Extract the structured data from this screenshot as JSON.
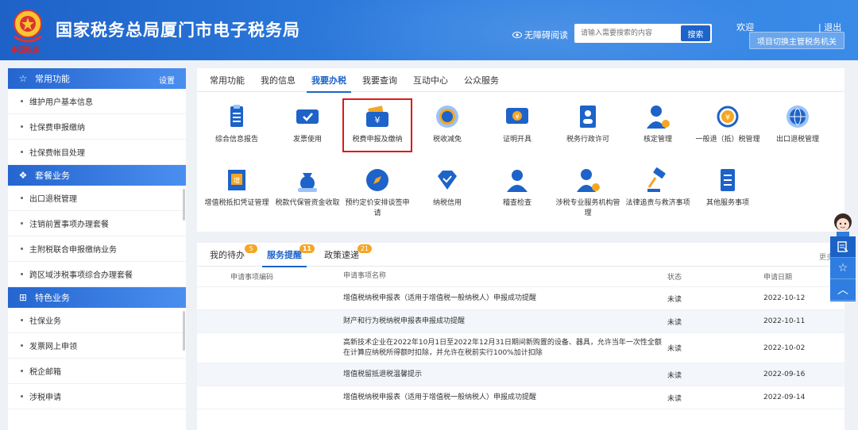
{
  "header": {
    "emblem_text": "中国税务",
    "title": "国家税务总局厦门市电子税务局",
    "accessibility": "无障碍阅读",
    "search_placeholder": "请输入需要搜索的内容",
    "search_button": "搜索",
    "welcome": "欢迎",
    "logout": "| 退出",
    "switch_agency": "项目切换主管税务机关"
  },
  "sidebar": {
    "sections": [
      {
        "title": "常用功能",
        "icon": "star-icon",
        "settings": "设置",
        "items": [
          "维护用户基本信息",
          "社保费申报缴纳",
          "社保费帐目处理"
        ]
      },
      {
        "title": "套餐业务",
        "icon": "layers-icon",
        "items": [
          "出口退税管理",
          "注销前置事项办理套餐",
          "主附税联合申报缴纳业务",
          "跨区域涉税事项综合办理套餐"
        ]
      },
      {
        "title": "特色业务",
        "icon": "grid-icon",
        "items": [
          "社保业务",
          "发票网上申领",
          "税企邮箱",
          "涉税申请"
        ]
      }
    ]
  },
  "main_tabs": [
    "常用功能",
    "我的信息",
    "我要办税",
    "我要查询",
    "互动中心",
    "公众服务"
  ],
  "active_main_tab": 2,
  "services": [
    {
      "label": "综合信息报告",
      "icon": "clipboard-icon"
    },
    {
      "label": "发票使用",
      "icon": "ticket-icon"
    },
    {
      "label": "税费申报及缴纳",
      "icon": "wallet-icon"
    },
    {
      "label": "税收减免",
      "icon": "coin-icon"
    },
    {
      "label": "证明开具",
      "icon": "certificate-icon"
    },
    {
      "label": "税务行政许可",
      "icon": "id-card-icon"
    },
    {
      "label": "核定管理",
      "icon": "user-gear-icon"
    },
    {
      "label": "一般退（抵）税管理",
      "icon": "refund-icon"
    },
    {
      "label": "出口退税管理",
      "icon": "globe-icon"
    },
    {
      "label": "增值税抵扣凭证管理",
      "icon": "invoice-icon"
    },
    {
      "label": "税款代保管资金收取",
      "icon": "money-bag-icon"
    },
    {
      "label": "预约定价安排谈签申请",
      "icon": "compass-icon"
    },
    {
      "label": "纳税信用",
      "icon": "diamond-icon"
    },
    {
      "label": "稽查检查",
      "icon": "inspector-icon"
    },
    {
      "label": "涉税专业服务机构管理",
      "icon": "agency-icon"
    },
    {
      "label": "法律追责与救济事项",
      "icon": "gavel-icon"
    },
    {
      "label": "其他服务事项",
      "icon": "list-icon"
    }
  ],
  "bottom_tabs": [
    {
      "label": "我的待办",
      "badge": "5"
    },
    {
      "label": "服务提醒",
      "badge": "11"
    },
    {
      "label": "政策速递",
      "badge": "21"
    }
  ],
  "active_bottom_tab": 1,
  "more_label": "更多",
  "table": {
    "headers": [
      "申请事项编码",
      "申请事项名称",
      "状态",
      "申请日期"
    ],
    "rows": [
      {
        "code": "",
        "name": "增值税纳税申报表（适用于增值税一般纳税人）申报成功提醒",
        "status": "未读",
        "date": "2022-10-12"
      },
      {
        "code": "",
        "name": "财产和行为税纳税申报表申报成功提醒",
        "status": "未读",
        "date": "2022-10-11"
      },
      {
        "code": "",
        "name": "高新技术企业在2022年10月1日至2022年12月31日期间新购置的设备、器具，允许当年一次性全额在计算应纳税所得额时扣除，并允许在税前实行100%加计扣除",
        "status": "未读",
        "date": "2022-10-02"
      },
      {
        "code": "",
        "name": "增值税留抵退税温馨提示",
        "status": "未读",
        "date": "2022-09-16"
      },
      {
        "code": "",
        "name": "增值税纳税申报表（适用于增值税一般纳税人）申报成功提醒",
        "status": "未读",
        "date": "2022-09-14"
      }
    ]
  },
  "colors": {
    "primary": "#1d63c9",
    "header_start": "#1e62c8",
    "header_end": "#3a8ae8",
    "highlight": "#e01818",
    "badge": "#f5a623"
  }
}
